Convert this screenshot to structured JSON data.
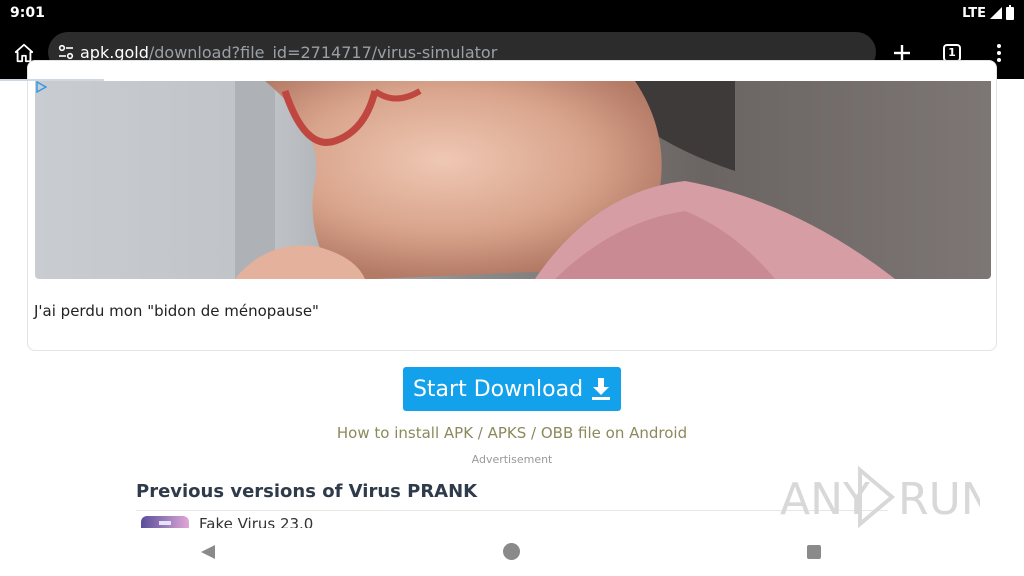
{
  "status_bar": {
    "time": "9:01",
    "network": "LTE"
  },
  "browser": {
    "url_domain": "apk.gold",
    "url_path": "/download?file_id=2714717/virus-simulator",
    "tab_count": "1"
  },
  "icons": {
    "home": "home-icon",
    "site_settings": "tune-icon",
    "new_tab": "plus-icon",
    "tabs": "tab-switcher-icon",
    "menu": "more-vert-icon",
    "download": "download-arrow-icon",
    "adchoices": "adchoices-icon"
  },
  "ad": {
    "caption": "J'ai perdu mon \"bidon de ménopause\""
  },
  "download": {
    "button_label": "Start Download",
    "install_link": "How to install APK / APKS / OBB file on Android",
    "advertisement_label": "Advertisement"
  },
  "previous_versions": {
    "title": "Previous versions of Virus PRANK",
    "items": [
      {
        "name": "Fake Virus 23.0"
      }
    ]
  },
  "watermark": {
    "text": "ANY RUN"
  },
  "colors": {
    "accent": "#13a1eb",
    "link": "#8a8a5c",
    "toolbar": "#000000",
    "url_bar": "#2c2c2c"
  }
}
